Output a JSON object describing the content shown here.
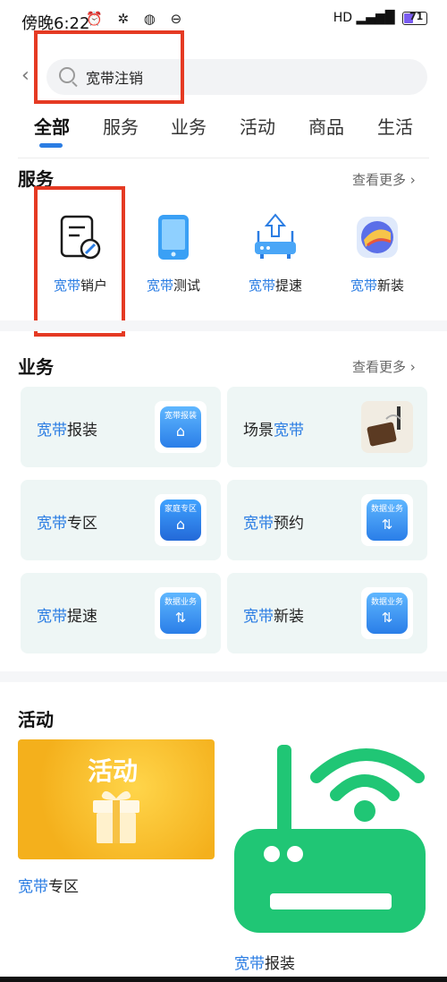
{
  "status_bar": {
    "time": "傍晚6:22",
    "icons": "⏰ ✲ ◍ ⊖",
    "signal": "HD ▂▄▆█ ",
    "battery": "71"
  },
  "search": {
    "query": "宽带注销",
    "back_icon": "chevron-left-icon",
    "search_icon": "magnifier-icon"
  },
  "tabs": [
    "全部",
    "服务",
    "业务",
    "活动",
    "商品",
    "生活"
  ],
  "services": {
    "title": "服务",
    "more": "查看更多 ›",
    "items": [
      {
        "prefix": "宽带",
        "suffix": "销户"
      },
      {
        "prefix": "宽带",
        "suffix": "测试"
      },
      {
        "prefix": "宽带",
        "suffix": "提速"
      },
      {
        "prefix": "宽带",
        "suffix": "新装"
      }
    ]
  },
  "business": {
    "title": "业务",
    "more": "查看更多 ›",
    "items": [
      {
        "prefix": "宽带",
        "suffix": "报装",
        "thumb_text": "宽带报装"
      },
      {
        "prefix": "场景",
        "suffix": "宽带",
        "thumb_text": ""
      },
      {
        "prefix": "宽带",
        "suffix": "专区",
        "thumb_text": "家庭专区"
      },
      {
        "prefix": "宽带",
        "suffix": "预约",
        "thumb_text": "数据业务"
      },
      {
        "prefix": "宽带",
        "suffix": "提速",
        "thumb_text": "数据业务"
      },
      {
        "prefix": "宽带",
        "suffix": "新装",
        "thumb_text": "数据业务"
      }
    ]
  },
  "activities": {
    "title": "活动",
    "items": [
      {
        "image_text": "活动",
        "prefix": "宽带",
        "suffix": "专区"
      },
      {
        "prefix": "宽带",
        "suffix": "报装"
      }
    ]
  },
  "colors": {
    "accent": "#2b7de3",
    "highlight_box": "#e53a23",
    "router_green": "#20c675"
  }
}
